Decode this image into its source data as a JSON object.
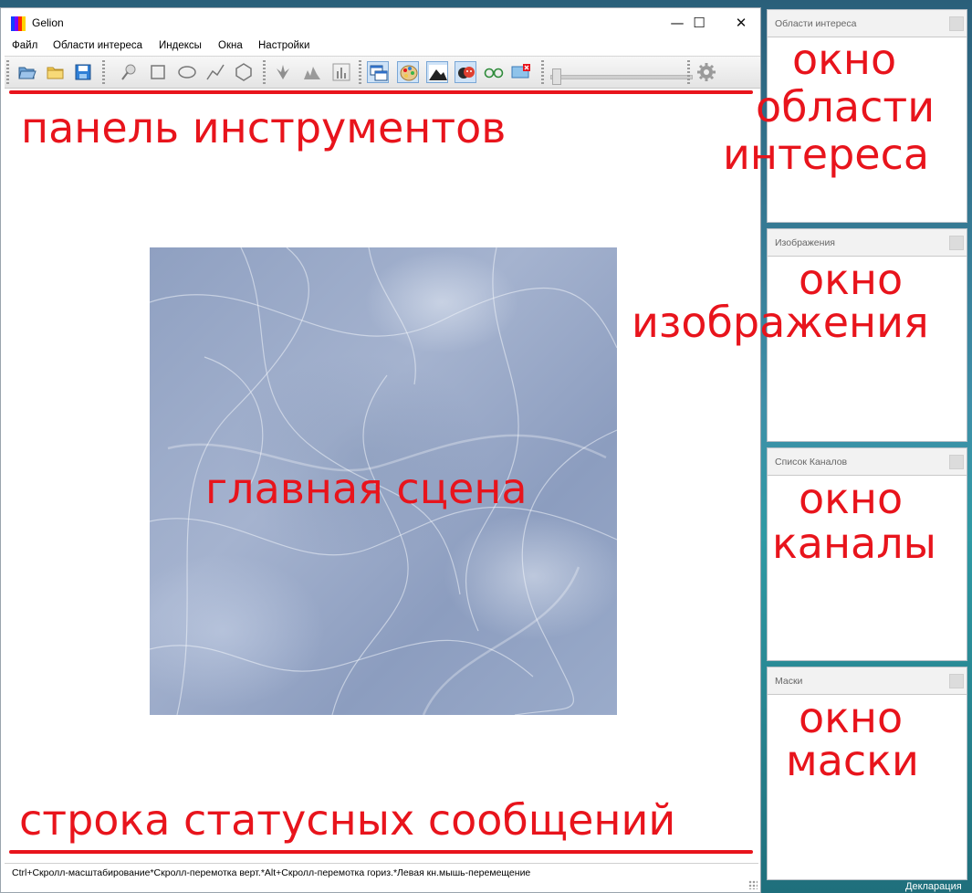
{
  "window": {
    "title": "Gelion",
    "controls": [
      "—",
      "☐",
      "✕"
    ]
  },
  "menu": [
    "Файл",
    "Области интереса",
    "Индексы",
    "Окна",
    "Настройки"
  ],
  "toolbar_icons": [
    "open-folder-icon",
    "folder-icon",
    "save-icon",
    "pin-icon",
    "rect-select-icon",
    "ellipse-select-icon",
    "polyline-icon",
    "polygon-icon",
    "plant-icon",
    "histogram-icon",
    "bar-chart-icon",
    "windows-icon",
    "palette-icon",
    "landscape-icon",
    "masks-icon",
    "glasses-icon",
    "close-image-icon",
    "settings-gear-icon"
  ],
  "annotations": {
    "toolbar": "панель инструментов",
    "scene": "главная сцена",
    "statusbar": "строка статусных сообщений",
    "roi": [
      "окно",
      "области",
      "интереса"
    ],
    "images": [
      "окно",
      "изображения"
    ],
    "channels": [
      "окно",
      "каналы"
    ],
    "masks": [
      "окно",
      "маски"
    ]
  },
  "panels": {
    "roi": "Области интереса",
    "images": "Изображения",
    "channels": "Список Каналов",
    "masks": "Маски"
  },
  "statusbar": "Ctrl+Скролл-масштабирование*Скролл-перемотка верт.*Alt+Скролл-перемотка гориз.*Левая кн.мышь-перемещение",
  "taskbar": "Декларация",
  "colors": {
    "annotation": "#e8141c",
    "scene": "#9aaac8"
  }
}
